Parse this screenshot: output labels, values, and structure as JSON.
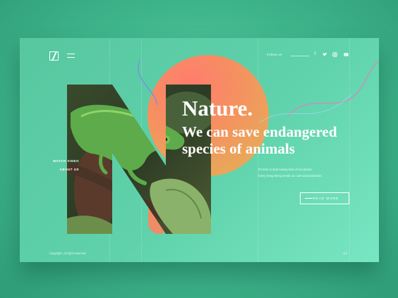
{
  "brand": {
    "logo_letter": "N"
  },
  "header": {
    "follow_label": "Follow us",
    "social_icons": [
      "facebook-icon",
      "twitter-icon",
      "instagram-icon",
      "youtube-icon"
    ]
  },
  "hero": {
    "title": "Nature.",
    "subtitle": "We can save endangered species of animals",
    "description_line1": "It's time to start saving lives of our planet.",
    "description_line2": "Every living being needs our care and protection.",
    "cta_label": "READ MORE"
  },
  "side_links": {
    "watch_video": "WATCH VIDEO",
    "about_us": "ABOUT US"
  },
  "footer": {
    "copyright": "Copyright. All right reserved",
    "page_indicator": "1/3"
  },
  "colors": {
    "accent_orange": "#f4935f",
    "accent_coral": "#ff7c6e",
    "card_green": "#5fd2ab"
  }
}
